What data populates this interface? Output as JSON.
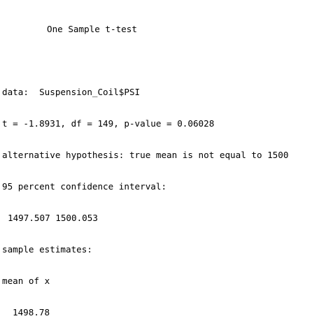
{
  "output": {
    "title": "One Sample t-test",
    "data_line": "data:  Suspension_Coil$PSI",
    "stats_line": "t = -1.8931, df = 149, p-value = 0.06028",
    "alt_hypothesis": "alternative hypothesis: true mean is not equal to 1500",
    "ci_label": "95 percent confidence interval:",
    "ci_values": "1497.507 1500.053",
    "estimates_label": "sample estimates:",
    "estimate_name": "mean of x",
    "estimate_value": "1498.78"
  }
}
